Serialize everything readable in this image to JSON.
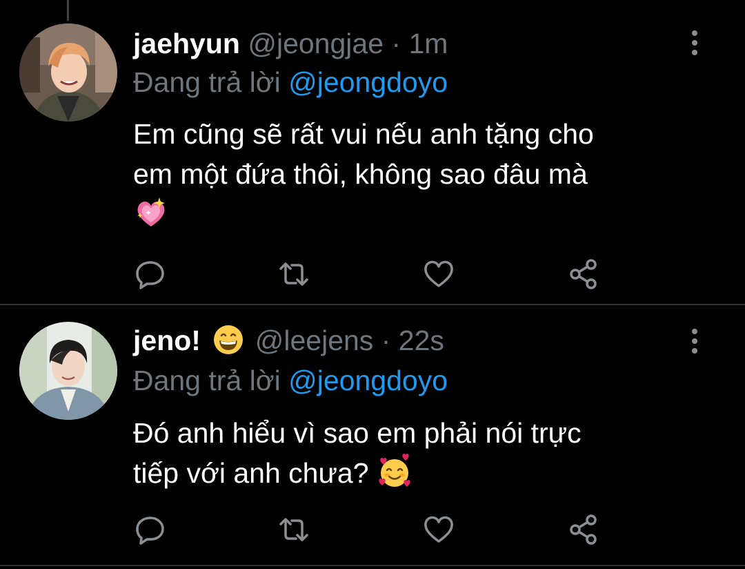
{
  "colors": {
    "background": "#000000",
    "text_primary": "#ffffff",
    "text_secondary": "#6e767d",
    "mention": "#1d9bf0",
    "divider": "#2f3336",
    "icon": "#8b9095"
  },
  "tweets": [
    {
      "display_name": "jaehyun",
      "name_emoji": "",
      "handle": "@jeongjae",
      "separator": "·",
      "time": "1m",
      "reply_prefix": "Đang trả lời",
      "reply_to": "@jeongdoyo",
      "text_line1": "Em cũng sẽ rất vui nếu anh tặng cho",
      "text_line2": "em một đứa thôi, không sao đâu mà",
      "text_emoji": "sparkling-heart",
      "actions": [
        "reply-icon",
        "retweet-icon",
        "like-icon",
        "share-icon"
      ]
    },
    {
      "display_name": "jeno!",
      "name_emoji": "grinning-face",
      "handle": "@leejens",
      "separator": "·",
      "time": "22s",
      "reply_prefix": "Đang trả lời",
      "reply_to": "@jeongdoyo",
      "text_line1": "Đó anh hiểu vì sao em phải nói trực",
      "text_line2": "tiếp với anh chưa?",
      "text_emoji": "smiling-face-with-hearts",
      "actions": [
        "reply-icon",
        "retweet-icon",
        "like-icon",
        "share-icon"
      ]
    }
  ]
}
